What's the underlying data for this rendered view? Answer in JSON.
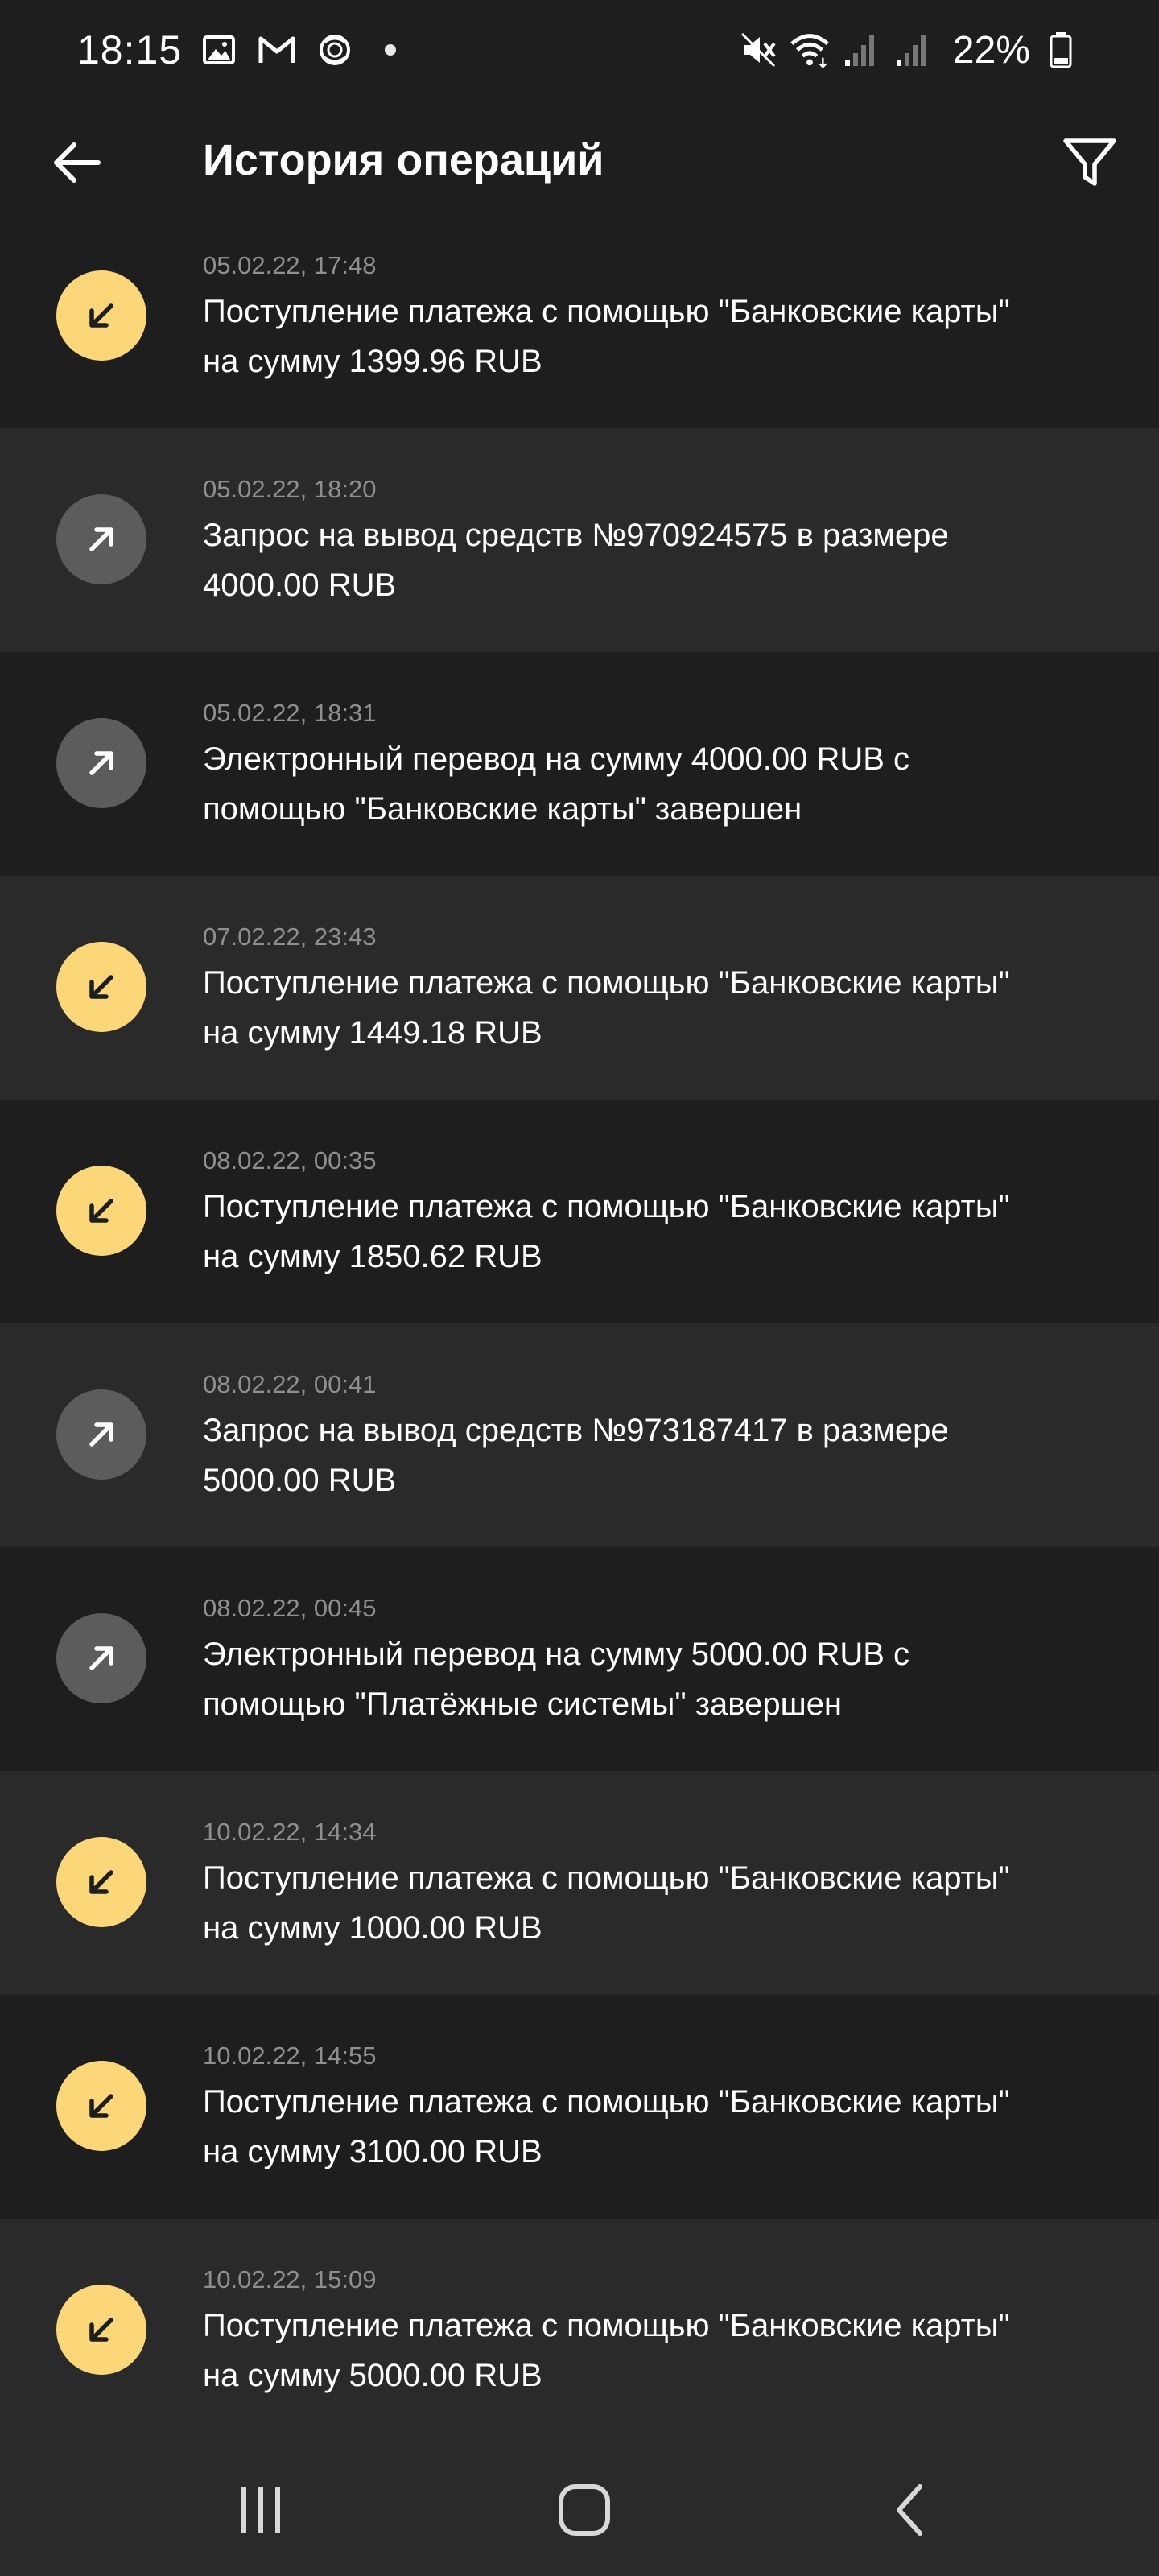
{
  "status_bar": {
    "time": "18:15",
    "battery": "22%",
    "left_icons": [
      "gallery-icon",
      "gmail-icon",
      "flower-icon"
    ],
    "right_icons": [
      "mute-icon",
      "wifi-icon",
      "signal-icon",
      "signal-icon",
      "battery-icon"
    ]
  },
  "header": {
    "title": "История операций"
  },
  "colors": {
    "incoming": "#fcd77a",
    "outgoing": "#5c5c5d",
    "background": "#1e1e1f",
    "row_alt": "#2a2a2b"
  },
  "operations": [
    {
      "type": "in",
      "date": "05.02.22, 17:48",
      "text": "Поступление платежа с помощью \"Банковские карты\" на сумму 1399.96 RUB"
    },
    {
      "type": "out",
      "date": "05.02.22, 18:20",
      "text": "Запрос на вывод средств №970924575 в размере 4000.00 RUB"
    },
    {
      "type": "out",
      "date": "05.02.22, 18:31",
      "text": "Электронный перевод на сумму 4000.00 RUB с помощью \"Банковские карты\" завершен"
    },
    {
      "type": "in",
      "date": "07.02.22, 23:43",
      "text": "Поступление платежа с помощью \"Банковские карты\" на сумму 1449.18 RUB"
    },
    {
      "type": "in",
      "date": "08.02.22, 00:35",
      "text": "Поступление платежа с помощью \"Банковские карты\" на сумму 1850.62 RUB"
    },
    {
      "type": "out",
      "date": "08.02.22, 00:41",
      "text": "Запрос на вывод средств №973187417 в размере 5000.00 RUB"
    },
    {
      "type": "out",
      "date": "08.02.22, 00:45",
      "text": "Электронный перевод на сумму 5000.00 RUB с помощью \"Платёжные системы\" завершен"
    },
    {
      "type": "in",
      "date": "10.02.22, 14:34",
      "text": "Поступление платежа с помощью \"Банковские карты\" на сумму 1000.00 RUB"
    },
    {
      "type": "in",
      "date": "10.02.22, 14:55",
      "text": "Поступление платежа с помощью \"Банковские карты\" на сумму 3100.00 RUB"
    },
    {
      "type": "in",
      "date": "10.02.22, 15:09",
      "text": "Поступление платежа с помощью \"Банковские карты\" на сумму 5000.00 RUB"
    }
  ],
  "nav_bar": {
    "buttons": [
      "recent-apps-icon",
      "home-icon",
      "back-icon"
    ]
  }
}
